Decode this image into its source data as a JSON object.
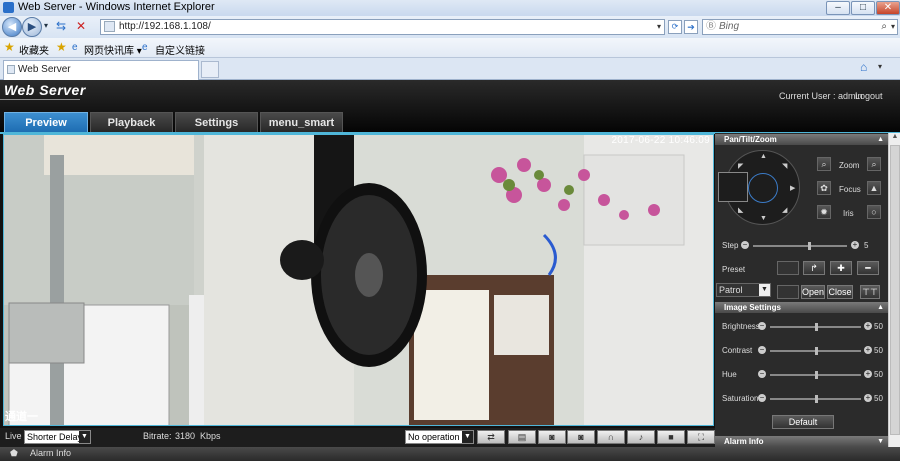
{
  "browser": {
    "window_title": "Web Server - Windows Internet Explorer",
    "address": "http://192.168.1.108/",
    "search_placeholder": "Bing",
    "favorites": {
      "fav_label": "收藏夹",
      "quick_label": "网页快讯库 ▾",
      "custom_label": "自定义链接"
    },
    "tab_title": "Web Server"
  },
  "app": {
    "logo": "Web Server",
    "current_user": "Current User : admin",
    "logout": "Logout",
    "tabs": [
      {
        "label": "Preview",
        "active": true
      },
      {
        "label": "Playback",
        "active": false
      },
      {
        "label": "Settings",
        "active": false
      },
      {
        "label": "menu_smart",
        "active": false
      }
    ]
  },
  "video": {
    "timestamp": "2017-06-22 10:46:09",
    "channel": "通道一"
  },
  "controls": {
    "live_label": "Live",
    "delay_value": "Shorter Delay",
    "bitrate_label": "Bitrate:",
    "bitrate_value": "3180",
    "bitrate_unit": "Kbps",
    "operation_value": "No operation"
  },
  "ptz": {
    "header": "Pan/Tilt/Zoom",
    "zoom_label": "Zoom",
    "focus_label": "Focus",
    "iris_label": "Iris",
    "step_label": "Step",
    "step_value": "5",
    "step_fraction": 0.6,
    "preset_label": "Preset",
    "patrol_value": "Patrol",
    "open_label": "Open",
    "close_label": "Close"
  },
  "image_settings": {
    "header": "Image Settings",
    "items": [
      {
        "label": "Brightness",
        "value": "50"
      },
      {
        "label": "Contrast",
        "value": "50"
      },
      {
        "label": "Hue",
        "value": "50"
      },
      {
        "label": "Saturation",
        "value": "50"
      }
    ],
    "default_label": "Default"
  },
  "alarm_panel": {
    "header": "Alarm Info"
  },
  "status": {
    "alarm_info": "Alarm Info"
  }
}
